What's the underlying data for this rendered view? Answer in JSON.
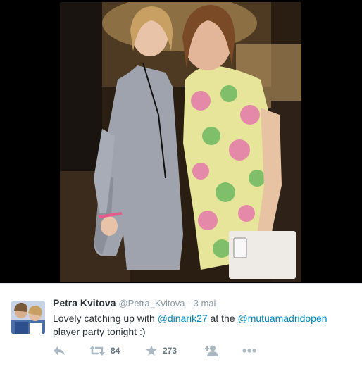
{
  "tweet": {
    "name": "Petra Kvitova",
    "handle": "@Petra_Kvitova",
    "separator": "·",
    "time": "3 mai",
    "text_part1": "Lovely catching up with ",
    "mention1": "@dinarik27",
    "text_part2": " at the ",
    "mention2": "@mutuamadridopen",
    "text_part3": " player party tonight :)"
  },
  "actions": {
    "reply_icon": "reply-icon",
    "retweet_icon": "retweet-icon",
    "retweet_count": "84",
    "favorite_icon": "star-icon",
    "favorite_count": "273",
    "follow_icon": "follow-icon",
    "more_icon": "more-icon"
  },
  "colors": {
    "link": "#0084b4",
    "action_icon": "#aab8c2",
    "name": "#292f33",
    "secondary": "#8899a6"
  }
}
